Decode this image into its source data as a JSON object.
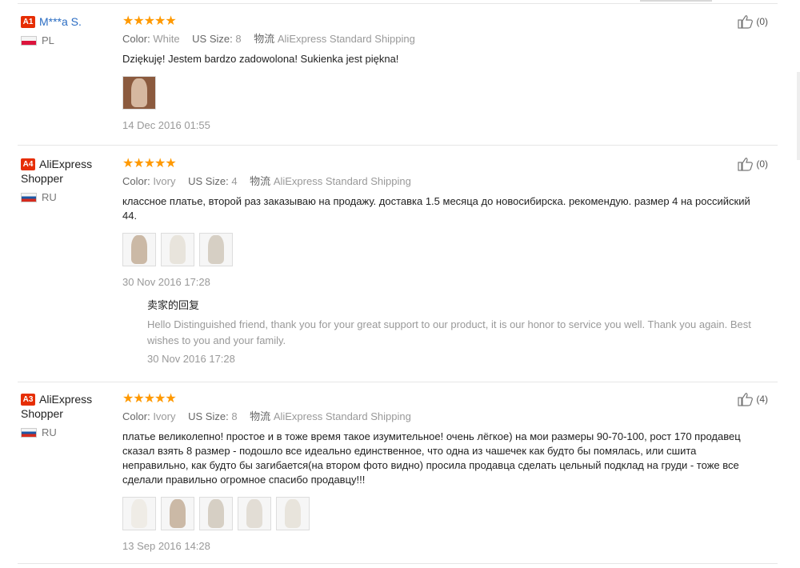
{
  "reviews": [
    {
      "badge": "A1",
      "name": "M***a S.",
      "country": "PL",
      "stars": "★★★★★",
      "color_label": "Color:",
      "color": "White",
      "size_label": "US Size:",
      "size": "8",
      "shipping_label": "物流",
      "shipping": "AliExpress Standard Shipping",
      "text": "Dziękuję! Jestem bardzo zadowolona! Sukienka jest piękna!",
      "date": "14 Dec 2016 01:55",
      "helpful": "(0)"
    },
    {
      "badge": "A4",
      "name": "AliExpress Shopper",
      "country": "RU",
      "stars": "★★★★★",
      "color_label": "Color:",
      "color": "Ivory",
      "size_label": "US Size:",
      "size": "4",
      "shipping_label": "物流",
      "shipping": "AliExpress Standard Shipping",
      "text": "классное платье, второй раз заказываю на продажу. доставка 1.5 месяца до новосибирска. рекомендую. размер 4 на российский 44.",
      "date": "30 Nov 2016 17:28",
      "helpful": "(0)",
      "reply": {
        "title": "卖家的回复",
        "text": "Hello Distinguished friend, thank you for your great support to our product, it is our honor to service you well. Thank you again. Best wishes to you and your family.",
        "date": "30 Nov 2016 17:28"
      }
    },
    {
      "badge": "A3",
      "name": "AliExpress Shopper",
      "country": "RU",
      "stars": "★★★★★",
      "color_label": "Color:",
      "color": "Ivory",
      "size_label": "US Size:",
      "size": "8",
      "shipping_label": "物流",
      "shipping": "AliExpress Standard Shipping",
      "text": "платье великолепно! простое и в тоже время такое изумительное! очень лёгкое) на мои размеры 90-70-100, рост 170 продавец сказал взять 8 размер - подошло все идеально единственное, что одна из чашечек как будто бы помялась, или сшита неправильно, как будто бы загибается(на втором фото видно) просила продавца сделать цельный подклад на груди - тоже все сделали правильно огромное спасибо продавцу!!!",
      "date": "13 Sep 2016 14:28",
      "helpful": "(4)"
    }
  ],
  "colors": {
    "badge": "#e62e04",
    "name_link": "#2b6dc3",
    "stars": "#ff9900"
  },
  "icons": {
    "helpful": "thumbs-up-icon",
    "flag_pl": "poland-flag-icon",
    "flag_ru": "russia-flag-icon"
  }
}
